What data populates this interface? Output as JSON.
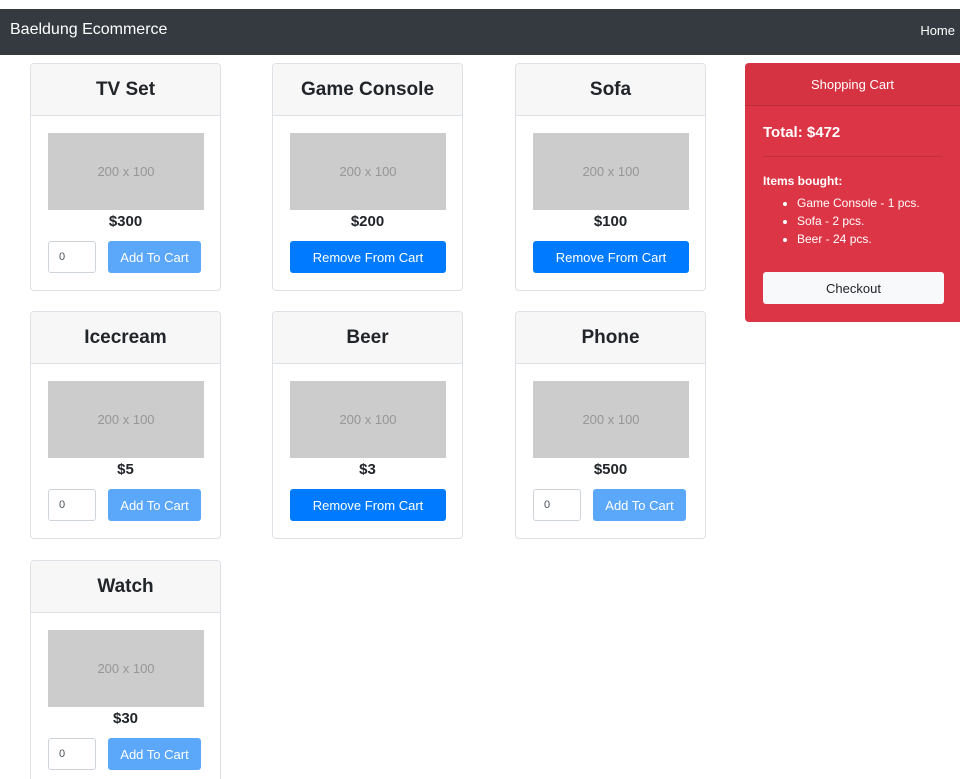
{
  "navbar": {
    "brand": "Baeldung Ecommerce",
    "home_link": "Home"
  },
  "colors": {
    "navbar_bg": "#343a40",
    "primary_button": "#007bff",
    "add_button": "#5ba7f9",
    "cart_bg": "#dc3545",
    "placeholder_bg": "#cccccc"
  },
  "products": [
    {
      "name": "TV Set",
      "image_label": "200 x 100",
      "price": "$300",
      "in_cart": false,
      "quantity": "0",
      "button_label": "Add To Cart"
    },
    {
      "name": "Game Console",
      "image_label": "200 x 100",
      "price": "$200",
      "in_cart": true,
      "button_label": "Remove From Cart"
    },
    {
      "name": "Sofa",
      "image_label": "200 x 100",
      "price": "$100",
      "in_cart": true,
      "button_label": "Remove From Cart"
    },
    {
      "name": "Icecream",
      "image_label": "200 x 100",
      "price": "$5",
      "in_cart": false,
      "quantity": "0",
      "button_label": "Add To Cart"
    },
    {
      "name": "Beer",
      "image_label": "200 x 100",
      "price": "$3",
      "in_cart": true,
      "button_label": "Remove From Cart"
    },
    {
      "name": "Phone",
      "image_label": "200 x 100",
      "price": "$500",
      "in_cart": false,
      "quantity": "0",
      "button_label": "Add To Cart"
    },
    {
      "name": "Watch",
      "image_label": "200 x 100",
      "price": "$30",
      "in_cart": false,
      "quantity": "0",
      "button_label": "Add To Cart"
    }
  ],
  "cart": {
    "header": "Shopping Cart",
    "total": "Total: $472",
    "items_label": "Items bought:",
    "items": [
      "Game Console - 1 pcs.",
      "Sofa - 2 pcs.",
      "Beer - 24 pcs."
    ],
    "checkout_label": "Checkout"
  }
}
